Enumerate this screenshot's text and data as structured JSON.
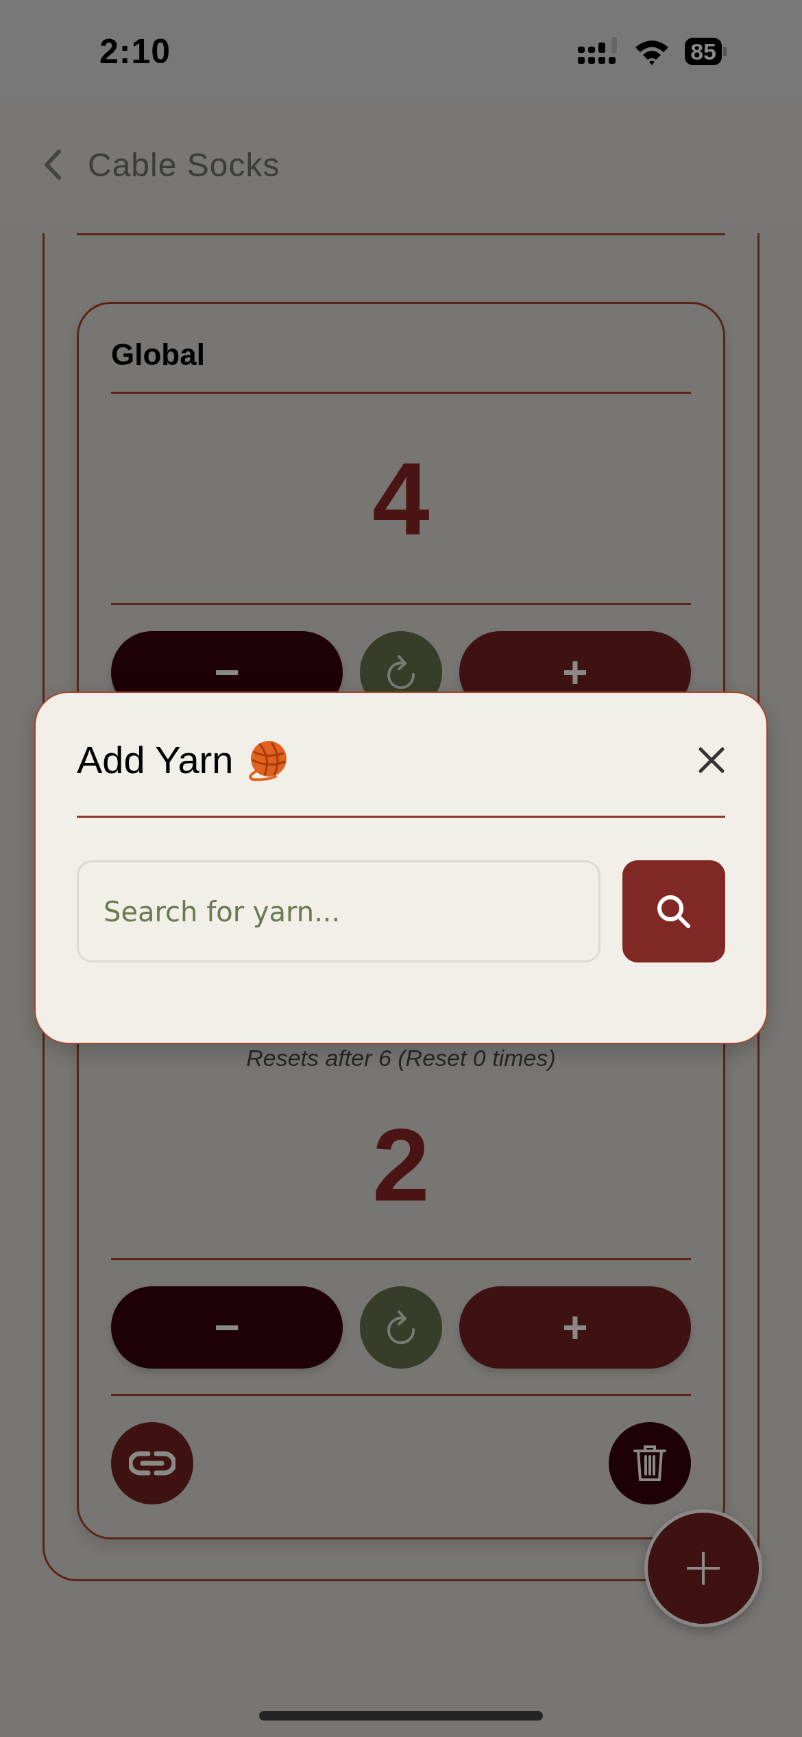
{
  "status_bar": {
    "time": "2:10",
    "battery": "85"
  },
  "nav": {
    "title": "Cable Socks"
  },
  "counters": [
    {
      "title": "Global",
      "value": "4",
      "decrement": "−",
      "increment": "+"
    },
    {
      "note": "Resets after 6 (Reset 0 times)",
      "value": "2",
      "decrement": "−",
      "increment": "+"
    }
  ],
  "modal": {
    "title": "Add Yarn",
    "search": {
      "placeholder": "Search for yarn..."
    }
  }
}
